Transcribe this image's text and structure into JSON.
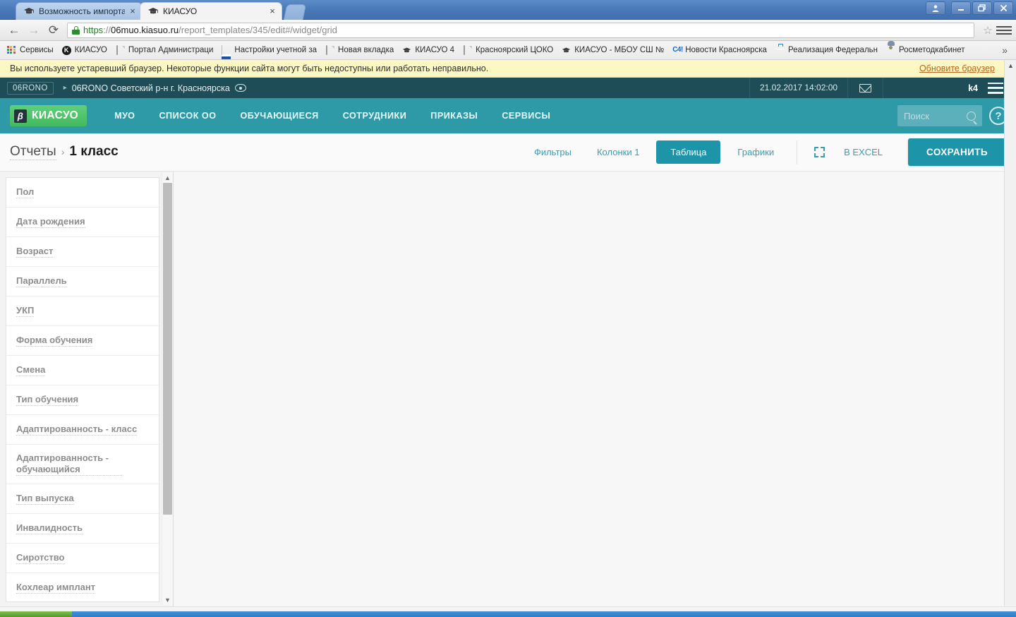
{
  "browser": {
    "tabs": [
      {
        "title": "Возможность импорта спис",
        "favicon": "graduation-cap-icon",
        "active": false,
        "close_label": "×"
      },
      {
        "title": "КИАСУО",
        "favicon": "graduation-cap-icon",
        "active": true,
        "close_label": "×"
      }
    ],
    "window_controls": {
      "profile": "●",
      "minimize": "–",
      "restore": "❐",
      "close": "✕"
    },
    "nav": {
      "back": "←",
      "forward": "→",
      "reload": "⟳",
      "star_icon": "☆",
      "menu_icon": "hamburger-icon"
    },
    "url": {
      "scheme": "https",
      "separator": "://",
      "host": "06muo.kiasuo.ru",
      "path": "/report_templates/345/edit#/widget/grid",
      "full": "https://06muo.kiasuo.ru/report_templates/345/edit#/widget/grid"
    },
    "bookmarks": [
      {
        "label": "Сервисы",
        "icon": "apps-grid-icon"
      },
      {
        "label": "КИАСУО",
        "icon": "circle-k-icon"
      },
      {
        "label": "Портал Администраци",
        "icon": "document-icon"
      },
      {
        "label": "Настройки учетной за",
        "icon": "russia-flag-icon"
      },
      {
        "label": "Новая вкладка",
        "icon": "document-icon"
      },
      {
        "label": "КИАСУО 4",
        "icon": "graduation-cap-icon"
      },
      {
        "label": "Красноярский ЦОКО",
        "icon": "document-icon"
      },
      {
        "label": "КИАСУО - МБОУ СШ №",
        "icon": "graduation-cap-icon"
      },
      {
        "label": "Новости Красноярска",
        "icon": "news-icon"
      },
      {
        "label": "Реализация Федеральн",
        "icon": "briefcase-icon"
      },
      {
        "label": "Росметодкабинет",
        "icon": "person-icon"
      }
    ],
    "bookmarks_overflow": "»"
  },
  "warning": {
    "text": "Вы используете устаревший браузер. Некоторые функции сайта могут быть недоступны или работать неправильно.",
    "link": "Обновите браузер"
  },
  "orgbar": {
    "chip": "06RONO",
    "caret": "▸",
    "path": "06RONO Советский р-н г. Красноярска",
    "eye_icon": "eye-icon",
    "datetime": "21.02.2017 14:02:00",
    "mail_icon": "mail-icon",
    "user": "k4",
    "menu_icon": "hamburger-icon"
  },
  "mainnav": {
    "logo_badge": "β",
    "logo_text": "КИАСУО",
    "links": [
      "МУО",
      "СПИСОК ОО",
      "ОБУЧАЮЩИЕСЯ",
      "СОТРУДНИКИ",
      "ПРИКАЗЫ",
      "СЕРВИСЫ"
    ],
    "search_placeholder": "Поиск",
    "search_value": "",
    "search_icon": "magnifier-icon",
    "help_label": "?"
  },
  "toolbar": {
    "breadcrumb_root": "Отчеты",
    "breadcrumb_sep": "›",
    "breadcrumb_leaf": "1 класс",
    "filters_label": "Фильтры",
    "columns_label": "Колонки 1",
    "table_label": "Таблица",
    "charts_label": "Графики",
    "fullscreen_icon": "expand-icon",
    "excel_label": "В EXCEL",
    "save_label": "СОХРАНИТЬ"
  },
  "sidebar": {
    "fields": [
      {
        "label": "Пол"
      },
      {
        "label": "Дата рождения"
      },
      {
        "label": "Возраст"
      },
      {
        "label": "Параллель"
      },
      {
        "label": "УКП"
      },
      {
        "label": "Форма обучения"
      },
      {
        "label": "Смена"
      },
      {
        "label": "Тип обучения"
      },
      {
        "label": "Адаптированность - класс"
      },
      {
        "label": "Адаптированность - обучающийся",
        "tall": true
      },
      {
        "label": "Тип выпуска"
      },
      {
        "label": "Инвалидность"
      },
      {
        "label": "Сиротство"
      },
      {
        "label": "Кохлеар имплант"
      }
    ],
    "scroll_up": "▲",
    "scroll_down": "▼"
  },
  "colors": {
    "brand_teal": "#2e9aa8",
    "brand_dark": "#1e4d57",
    "accent_button": "#1d94a8",
    "logo_green": "#4fc46f",
    "warning_bg": "#fdf7c3",
    "warning_link": "#b5651d"
  }
}
